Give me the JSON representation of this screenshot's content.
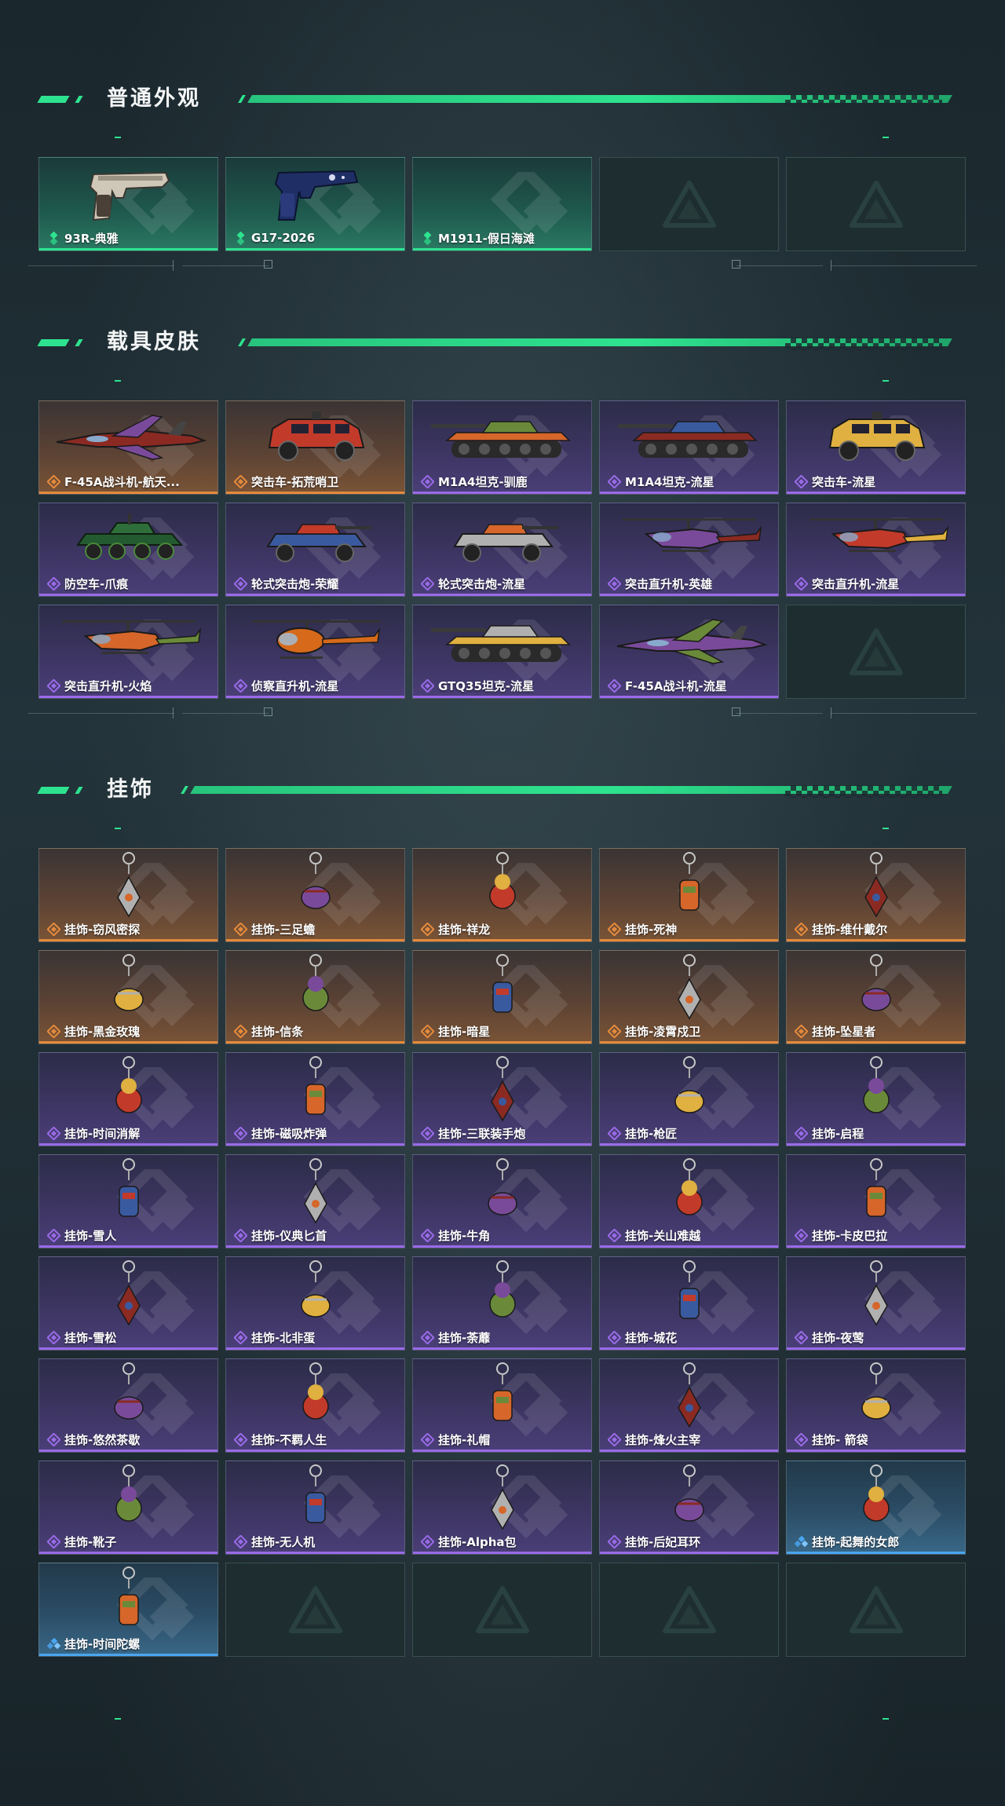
{
  "colors": {
    "accent": "#2ee38f",
    "rarity_green": "#2ee38f",
    "rarity_orange": "#e58a3c",
    "rarity_purple": "#9a6ae8",
    "rarity_blue": "#4aa6f0"
  },
  "sections": [
    {
      "title": "普通外观",
      "items": [
        {
          "label": "93R-典雅",
          "rarity": "green",
          "icon": "pistol-icon"
        },
        {
          "label": "G17-2026",
          "rarity": "green",
          "icon": "pistol-blue-icon"
        },
        {
          "label": "M1911-假日海滩",
          "rarity": "green",
          "icon": ""
        },
        {
          "label": "",
          "rarity": "empty",
          "icon": ""
        },
        {
          "label": "",
          "rarity": "empty",
          "icon": ""
        }
      ]
    },
    {
      "title": "载具皮肤",
      "items": [
        {
          "label": "F-45A战斗机-航天...",
          "rarity": "orange",
          "icon": "jet-icon"
        },
        {
          "label": "突击车-拓荒哨卫",
          "rarity": "orange",
          "icon": "armored-car-icon"
        },
        {
          "label": "M1A4坦克-驯鹿",
          "rarity": "purple",
          "icon": "tank-icon"
        },
        {
          "label": "M1A4坦克-流星",
          "rarity": "purple",
          "icon": "tank-icon"
        },
        {
          "label": "突击车-流星",
          "rarity": "purple",
          "icon": "armored-car-icon"
        },
        {
          "label": "防空车-爪痕",
          "rarity": "purple",
          "icon": "aa-vehicle-icon"
        },
        {
          "label": "轮式突击炮-荣耀",
          "rarity": "purple",
          "icon": "wheeled-gun-icon"
        },
        {
          "label": "轮式突击炮-流星",
          "rarity": "purple",
          "icon": "wheeled-gun-icon"
        },
        {
          "label": "突击直升机-英雄",
          "rarity": "purple",
          "icon": "helicopter-icon"
        },
        {
          "label": "突击直升机-流星",
          "rarity": "purple",
          "icon": "helicopter-icon"
        },
        {
          "label": "突击直升机-火焰",
          "rarity": "purple",
          "icon": "helicopter-icon"
        },
        {
          "label": "侦察直升机-流星",
          "rarity": "purple",
          "icon": "scout-helicopter-icon"
        },
        {
          "label": "GTQ35坦克-流星",
          "rarity": "purple",
          "icon": "tank-icon"
        },
        {
          "label": "F-45A战斗机-流星",
          "rarity": "purple",
          "icon": "jet-icon"
        },
        {
          "label": "",
          "rarity": "empty",
          "icon": ""
        }
      ]
    },
    {
      "title": "挂饰",
      "items": [
        {
          "label": "挂饰-窃风密探",
          "rarity": "orange",
          "icon": "charm-icon"
        },
        {
          "label": "挂饰-三足蟾",
          "rarity": "orange",
          "icon": "charm-icon"
        },
        {
          "label": "挂饰-祥龙",
          "rarity": "orange",
          "icon": "charm-icon"
        },
        {
          "label": "挂饰-死神",
          "rarity": "orange",
          "icon": "charm-icon"
        },
        {
          "label": "挂饰-维什戴尔",
          "rarity": "orange",
          "icon": "charm-icon"
        },
        {
          "label": "挂饰-黑金玫瑰",
          "rarity": "orange",
          "icon": "charm-icon"
        },
        {
          "label": "挂饰-信条",
          "rarity": "orange",
          "icon": "charm-icon"
        },
        {
          "label": "挂饰-暗星",
          "rarity": "orange",
          "icon": "charm-icon"
        },
        {
          "label": "挂饰-凌霄戍卫",
          "rarity": "orange",
          "icon": "charm-icon"
        },
        {
          "label": "挂饰-坠星者",
          "rarity": "orange",
          "icon": "charm-icon"
        },
        {
          "label": "挂饰-时间消解",
          "rarity": "purple",
          "icon": "charm-icon"
        },
        {
          "label": "挂饰-磁吸炸弹",
          "rarity": "purple",
          "icon": "charm-icon"
        },
        {
          "label": "挂饰-三联装手炮",
          "rarity": "purple",
          "icon": "charm-icon"
        },
        {
          "label": "挂饰-枪匠",
          "rarity": "purple",
          "icon": "charm-icon"
        },
        {
          "label": "挂饰-启程",
          "rarity": "purple",
          "icon": "charm-icon"
        },
        {
          "label": "挂饰-雪人",
          "rarity": "purple",
          "icon": "charm-icon"
        },
        {
          "label": "挂饰-仪典匕首",
          "rarity": "purple",
          "icon": "charm-icon"
        },
        {
          "label": "挂饰-牛角",
          "rarity": "purple",
          "icon": "charm-icon"
        },
        {
          "label": "挂饰-关山难越",
          "rarity": "purple",
          "icon": "charm-icon"
        },
        {
          "label": "挂饰-卡皮巴拉",
          "rarity": "purple",
          "icon": "charm-icon"
        },
        {
          "label": "挂饰-雪松",
          "rarity": "purple",
          "icon": "charm-icon"
        },
        {
          "label": "挂饰-北非蛋",
          "rarity": "purple",
          "icon": "charm-icon"
        },
        {
          "label": "挂饰-荼蘼",
          "rarity": "purple",
          "icon": "charm-icon"
        },
        {
          "label": "挂饰-城花",
          "rarity": "purple",
          "icon": "charm-icon"
        },
        {
          "label": "挂饰-夜莺",
          "rarity": "purple",
          "icon": "charm-icon"
        },
        {
          "label": "挂饰-悠然茶歇",
          "rarity": "purple",
          "icon": "charm-icon"
        },
        {
          "label": "挂饰-不羁人生",
          "rarity": "purple",
          "icon": "charm-icon"
        },
        {
          "label": "挂饰-礼帽",
          "rarity": "purple",
          "icon": "charm-icon"
        },
        {
          "label": "挂饰-烽火主宰",
          "rarity": "purple",
          "icon": "charm-icon"
        },
        {
          "label": "挂饰- 箭袋",
          "rarity": "purple",
          "icon": "charm-icon"
        },
        {
          "label": "挂饰-靴子",
          "rarity": "purple",
          "icon": "charm-icon"
        },
        {
          "label": "挂饰-无人机",
          "rarity": "purple",
          "icon": "charm-icon"
        },
        {
          "label": "挂饰-Alpha包",
          "rarity": "purple",
          "icon": "charm-icon"
        },
        {
          "label": "挂饰-后妃耳环",
          "rarity": "purple",
          "icon": "charm-icon"
        },
        {
          "label": "挂饰-起舞的女郎",
          "rarity": "blue",
          "icon": "charm-icon"
        },
        {
          "label": "挂饰-时间陀螺",
          "rarity": "blue",
          "icon": "charm-icon"
        },
        {
          "label": "",
          "rarity": "empty",
          "icon": ""
        },
        {
          "label": "",
          "rarity": "empty",
          "icon": ""
        },
        {
          "label": "",
          "rarity": "empty",
          "icon": ""
        },
        {
          "label": "",
          "rarity": "empty",
          "icon": ""
        }
      ]
    }
  ]
}
